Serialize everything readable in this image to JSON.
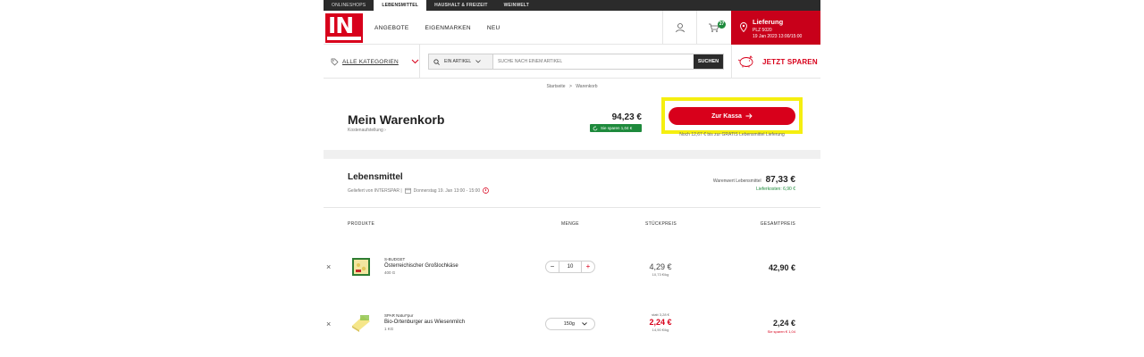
{
  "topbar": {
    "tabs": [
      "ONLINESHOPS",
      "LEBENSMITTEL",
      "HAUSHALT & FREIZEIT",
      "WEINWELT"
    ],
    "active_tab": "LEBENSMITTEL"
  },
  "header": {
    "logo_text": "IN",
    "nav": [
      "ANGEBOTE",
      "EIGENMARKEN",
      "NEU"
    ],
    "cart_count": "27",
    "delivery": {
      "title": "Lieferung",
      "postal": "PLZ 5020",
      "slot": "19 Jan 2023  13:00/15:00"
    }
  },
  "search": {
    "categories_label": "ALLE KATEGORIEN",
    "scope": "EIN ARTIKEL",
    "placeholder": "SUCHE NACH EINEM ARTIKEL",
    "button": "SUCHEN",
    "save_label": "JETZT SPAREN"
  },
  "breadcrumb": {
    "home": "Startseite",
    "sep": ">",
    "current": "Warenkorb"
  },
  "cart": {
    "title": "Mein Warenkorb",
    "costs_link": "Kostenaufstellung",
    "total": "94,23 €",
    "savings": "Sie sparen 1,04 €",
    "checkout": "Zur Kassa",
    "free_delivery_hint": "Noch 12,67 € bis zur GRATIS Lebensmittel Lieferung"
  },
  "section": {
    "title": "Lebensmittel",
    "meta": "Geliefert von INTERSPAR |",
    "slot": "Donnerstag 19. Jan 13:00 - 15:00",
    "value_label": "Warenwert Lebensmittel",
    "value": "87,33 €",
    "delivery_cost": "Lieferkosten: 6,90 €"
  },
  "table": {
    "headers": {
      "products": "PRODUKTE",
      "quantity": "MENGE",
      "unit_price": "STÜCKPREIS",
      "total": "GESAMTPREIS"
    },
    "rows": [
      {
        "brand": "S-BUDGET",
        "name": "Österreichischer Großlochkäse",
        "size": "400 G",
        "quantity": "10",
        "unit_price": "4,29 €",
        "unit_base": "10,73 €/kg",
        "total": "42,90 €"
      },
      {
        "brand": "SPAR Natur*pur",
        "name": "Bio-Ortenburger aus Wiesenmilch",
        "size": "1 KG",
        "quantity": "150g",
        "old_price": "statt 3,28 €",
        "unit_price": "2,24 €",
        "unit_base": "14,90 €/kg",
        "total": "2,24 €",
        "savings": "Sie sparen € 1,04"
      }
    ]
  },
  "colors": {
    "brand_red": "#d8001b",
    "green": "#1e8a3c",
    "highlight": "#f5ef10"
  }
}
